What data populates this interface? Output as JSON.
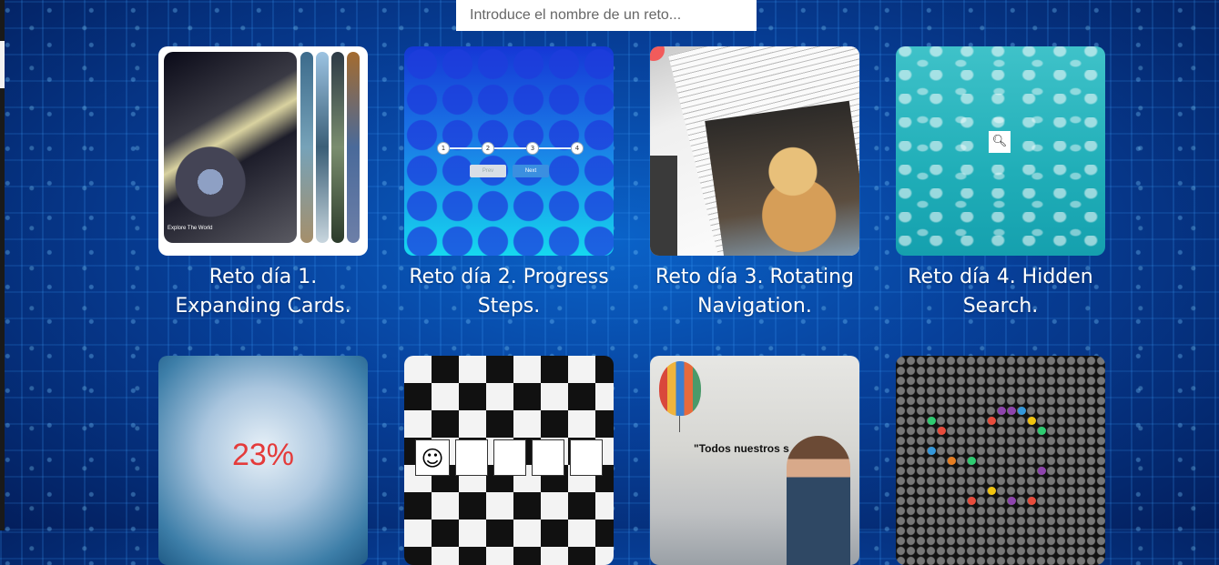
{
  "search": {
    "placeholder": "Introduce el nombre de un reto..."
  },
  "cards": [
    {
      "title": "Reto día 1. Expanding Cards.",
      "thumb_caption": "Explore The World"
    },
    {
      "title": "Reto día 2. Progress Steps.",
      "steps": [
        "1",
        "2",
        "3",
        "4"
      ],
      "prev_label": "Prev",
      "next_label": "Next"
    },
    {
      "title": "Reto día 3. Rotating Navigation."
    },
    {
      "title": "Reto día 4. Hidden Search.",
      "search_icon": "search-icon"
    },
    {
      "title": "",
      "percent": "23%"
    },
    {
      "title": ""
    },
    {
      "title": "",
      "quote": "\"Todos nuestros s"
    },
    {
      "title": ""
    }
  ],
  "colors": {
    "background": "#07409a",
    "title_text": "#ffffff",
    "percent_red": "#e43b3b"
  }
}
